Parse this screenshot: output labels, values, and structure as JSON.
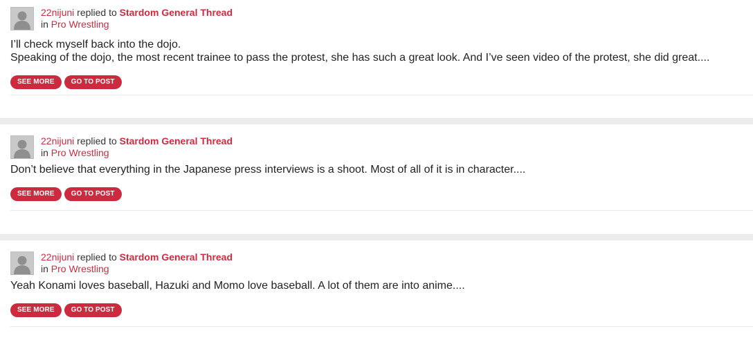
{
  "colors": {
    "accent": "#cc2b3f",
    "divider": "#ececec"
  },
  "posts": [
    {
      "user": "22nijuni",
      "verb": "replied to",
      "thread": "Stardom General Thread",
      "in": "in",
      "forum": "Pro Wrestling",
      "lines": [
        "I’ll check myself back into the dojo.",
        "Speaking of the dojo, the most recent trainee to pass the protest, she has such a great look. And I’ve seen video of the protest, she did great...."
      ],
      "see_more": "SEE MORE",
      "go_to_post": "GO TO POST",
      "avatar_icon": "user-avatar-icon"
    },
    {
      "user": "22nijuni",
      "verb": "replied to",
      "thread": "Stardom General Thread",
      "in": "in",
      "forum": "Pro Wrestling",
      "lines": [
        "Don’t believe that everything in the Japanese press interviews is a shoot. Most of all of it is in character...."
      ],
      "see_more": "SEE MORE",
      "go_to_post": "GO TO POST",
      "avatar_icon": "user-avatar-icon"
    },
    {
      "user": "22nijuni",
      "verb": "replied to",
      "thread": "Stardom General Thread",
      "in": "in",
      "forum": "Pro Wrestling",
      "lines": [
        "Yeah Konami loves baseball, Hazuki and Momo love baseball. A lot of them are into anime...."
      ],
      "see_more": "SEE MORE",
      "go_to_post": "GO TO POST",
      "avatar_icon": "user-avatar-icon"
    }
  ]
}
